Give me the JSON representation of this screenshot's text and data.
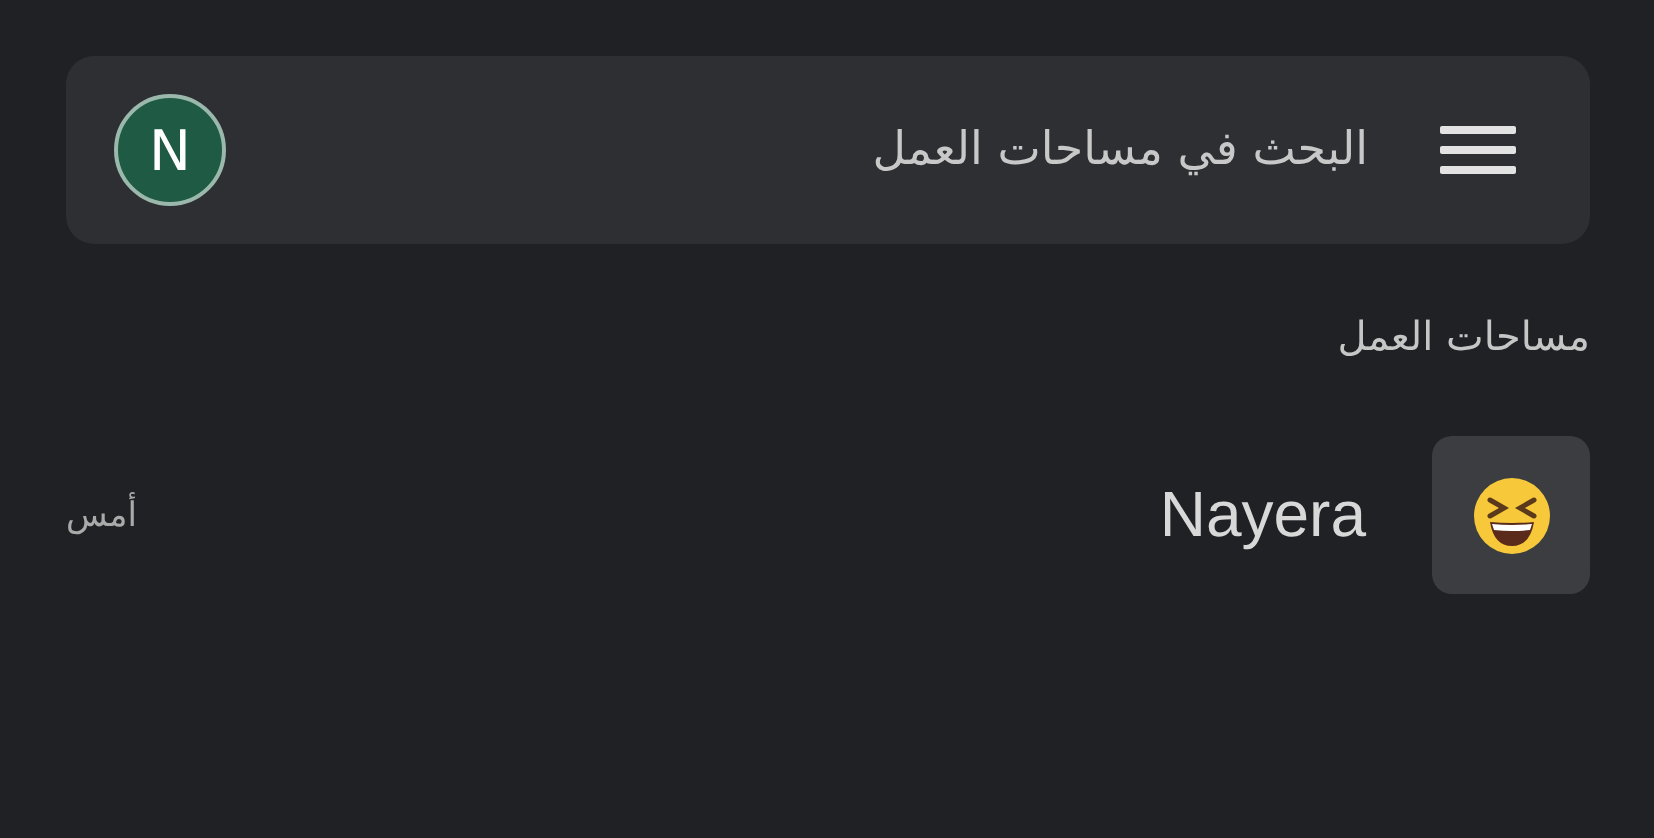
{
  "search": {
    "placeholder": "البحث في مساحات العمل",
    "avatar_letter": "N"
  },
  "section_title": "مساحات العمل",
  "workspaces": [
    {
      "name": "Nayera",
      "time": "أمس"
    }
  ]
}
